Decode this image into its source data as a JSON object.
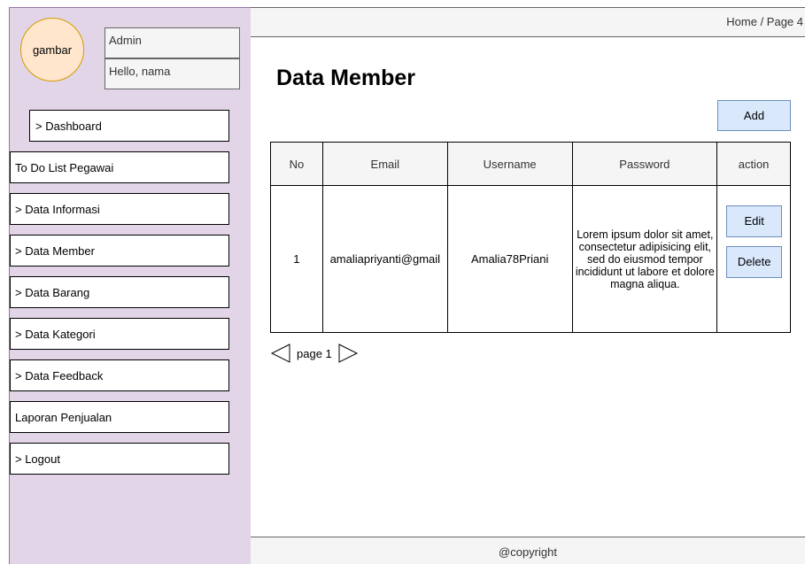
{
  "sidebar": {
    "avatar_label": "gambar",
    "role": "Admin",
    "greeting": "Hello, nama",
    "items": [
      {
        "label": "> Dashboard"
      },
      {
        "label": "To Do List Pegawai"
      },
      {
        "label": "> Data Informasi"
      },
      {
        "label": "> Data Member"
      },
      {
        "label": "> Data Barang"
      },
      {
        "label": "> Data Kategori"
      },
      {
        "label": "> Data Feedback"
      },
      {
        "label": "Laporan Penjualan"
      },
      {
        "label": "> Logout"
      }
    ]
  },
  "header": {
    "breadcrumb": "Home / Page 4"
  },
  "main": {
    "title": "Data Member",
    "add_label": "Add",
    "table": {
      "headers": [
        "No",
        "Email",
        "Username",
        "Password",
        "action"
      ],
      "rows": [
        {
          "no": "1",
          "email": "amaliapriyanti@gmail",
          "username": "Amalia78Priani",
          "password": "Lorem ipsum dolor sit amet, consectetur adipisicing elit, sed do eiusmod tempor incididunt ut labore et dolore magna aliqua.",
          "edit_label": "Edit",
          "delete_label": "Delete"
        }
      ]
    },
    "pagination": {
      "label": "page 1"
    }
  },
  "footer": {
    "text": "@copyright"
  },
  "colors": {
    "sidebar_bg": "#e1d5e7",
    "avatar_bg": "#ffe6cc",
    "button_bg": "#dae8fc",
    "bar_bg": "#f5f5f5"
  }
}
